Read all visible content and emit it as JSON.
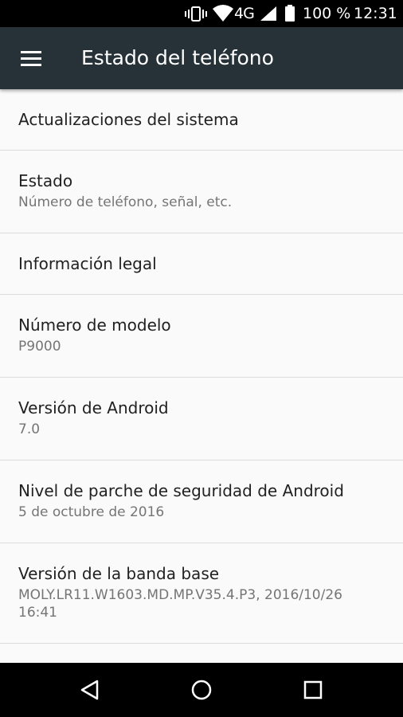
{
  "status_bar": {
    "network": "4G",
    "battery": "100 %",
    "time": "12:31",
    "icons": [
      "vibrate-icon",
      "wifi-icon",
      "signal-icon",
      "battery-icon"
    ]
  },
  "toolbar": {
    "title": "Estado del teléfono",
    "menu_icon": "hamburger-menu-icon"
  },
  "items": [
    {
      "title": "Actualizaciones del sistema",
      "summary": ""
    },
    {
      "title": "Estado",
      "summary": "Número de teléfono, señal, etc."
    },
    {
      "title": "Información legal",
      "summary": ""
    },
    {
      "title": "Número de modelo",
      "summary": "P9000"
    },
    {
      "title": "Versión de Android",
      "summary": "7.0"
    },
    {
      "title": "Nivel de parche de seguridad de Android",
      "summary": "5 de octubre de 2016"
    },
    {
      "title": "Versión de la banda base",
      "summary": "MOLY.LR11.W1603.MD.MP.V35.4.P3, 2016/10/26 16:41"
    }
  ],
  "nav_bar": {
    "icons": [
      "back-icon",
      "home-icon",
      "recents-icon"
    ]
  },
  "colors": {
    "toolbar": "#263238",
    "background": "#fafafa",
    "title_text": "#212121",
    "summary_text": "#757575",
    "divider": "#dcdcdc"
  }
}
